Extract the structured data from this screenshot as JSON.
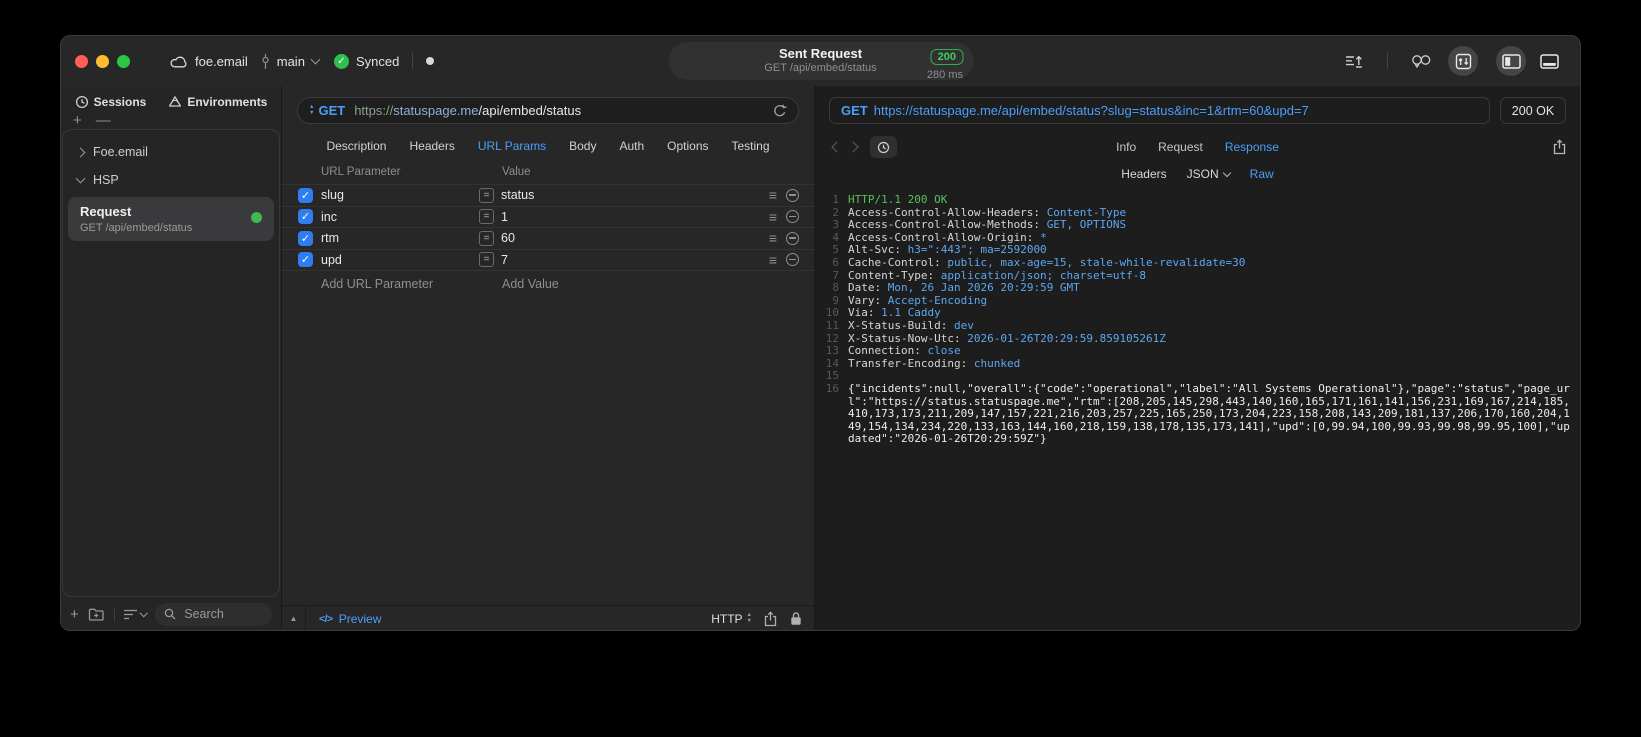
{
  "titlebar": {
    "project": "foe.email",
    "branch": "main",
    "sync_label": "Synced",
    "request_title": "Sent Request",
    "request_subtitle": "GET /api/embed/status",
    "status_code": "200",
    "duration": "280 ms"
  },
  "sidebar": {
    "tabs": [
      {
        "label": "Sessions"
      },
      {
        "label": "Environments"
      }
    ],
    "tree": [
      {
        "label": "Foe.email"
      },
      {
        "label": "HSP"
      }
    ],
    "request": {
      "title": "Request",
      "subtitle": "GET /api/embed/status"
    },
    "search_placeholder": "Search"
  },
  "request_editor": {
    "method": "GET",
    "url_scheme": "https://",
    "url_host": "statuspage.me",
    "url_path": "/api/embed/status",
    "tabs": [
      "Description",
      "Headers",
      "URL Params",
      "Body",
      "Auth",
      "Options",
      "Testing"
    ],
    "active_tab": "URL Params",
    "params": {
      "col_name": "URL Parameter",
      "col_value": "Value",
      "rows": [
        {
          "name": "slug",
          "value": "status",
          "checked": true
        },
        {
          "name": "inc",
          "value": "1",
          "checked": true
        },
        {
          "name": "rtm",
          "value": "60",
          "checked": true
        },
        {
          "name": "upd",
          "value": "7",
          "checked": true
        }
      ],
      "add_name": "Add URL Parameter",
      "add_value": "Add Value"
    },
    "footer": {
      "preview": "Preview",
      "code_glyph": "</>",
      "protocol": "HTTP"
    }
  },
  "response_viewer": {
    "method": "GET",
    "url": "https://statuspage.me/api/embed/status?slug=status&inc=1&rtm=60&upd=7",
    "status": "200 OK",
    "tabs": [
      "Info",
      "Request",
      "Response"
    ],
    "active_tab": "Response",
    "view_tabs": [
      "Headers",
      "JSON",
      "Raw"
    ],
    "active_view": "Raw",
    "status_line": "HTTP/1.1 200 OK",
    "headers": [
      {
        "name": "Access-Control-Allow-Headers",
        "value": "Content-Type"
      },
      {
        "name": "Access-Control-Allow-Methods",
        "value": "GET, OPTIONS"
      },
      {
        "name": "Access-Control-Allow-Origin",
        "value": "*"
      },
      {
        "name": "Alt-Svc",
        "value": "h3=\":443\"; ma=2592000"
      },
      {
        "name": "Cache-Control",
        "value": "public, max-age=15, stale-while-revalidate=30"
      },
      {
        "name": "Content-Type",
        "value": "application/json; charset=utf-8"
      },
      {
        "name": "Date",
        "value": "Mon, 26 Jan 2026 20:29:59 GMT"
      },
      {
        "name": "Vary",
        "value": "Accept-Encoding"
      },
      {
        "name": "Via",
        "value": "1.1 Caddy"
      },
      {
        "name": "X-Status-Build",
        "value": "dev"
      },
      {
        "name": "X-Status-Now-Utc",
        "value": "2026-01-26T20:29:59.859105261Z"
      },
      {
        "name": "Connection",
        "value": "close"
      },
      {
        "name": "Transfer-Encoding",
        "value": "chunked"
      }
    ],
    "body": "{\"incidents\":null,\"overall\":{\"code\":\"operational\",\"label\":\"All Systems Operational\"},\"page\":\"status\",\"page_url\":\"https://status.statuspage.me\",\"rtm\":[208,205,145,298,443,140,160,165,171,161,141,156,231,169,167,214,185,410,173,173,211,209,147,157,221,216,203,257,225,165,250,173,204,223,158,208,143,209,181,137,206,170,160,204,149,154,134,234,220,133,163,144,160,218,159,138,178,135,173,141],\"upd\":[0,99.94,100,99.93,99.98,99.95,100],\"updated\":\"2026-01-26T20:29:59Z\"}"
  },
  "colors": {
    "accent_blue": "#4b9ef9",
    "status_green": "#3fd158",
    "checkbox_blue": "#2e7ef0",
    "code_value_blue": "#5ca7f0",
    "code_status_green": "#55c25b"
  }
}
